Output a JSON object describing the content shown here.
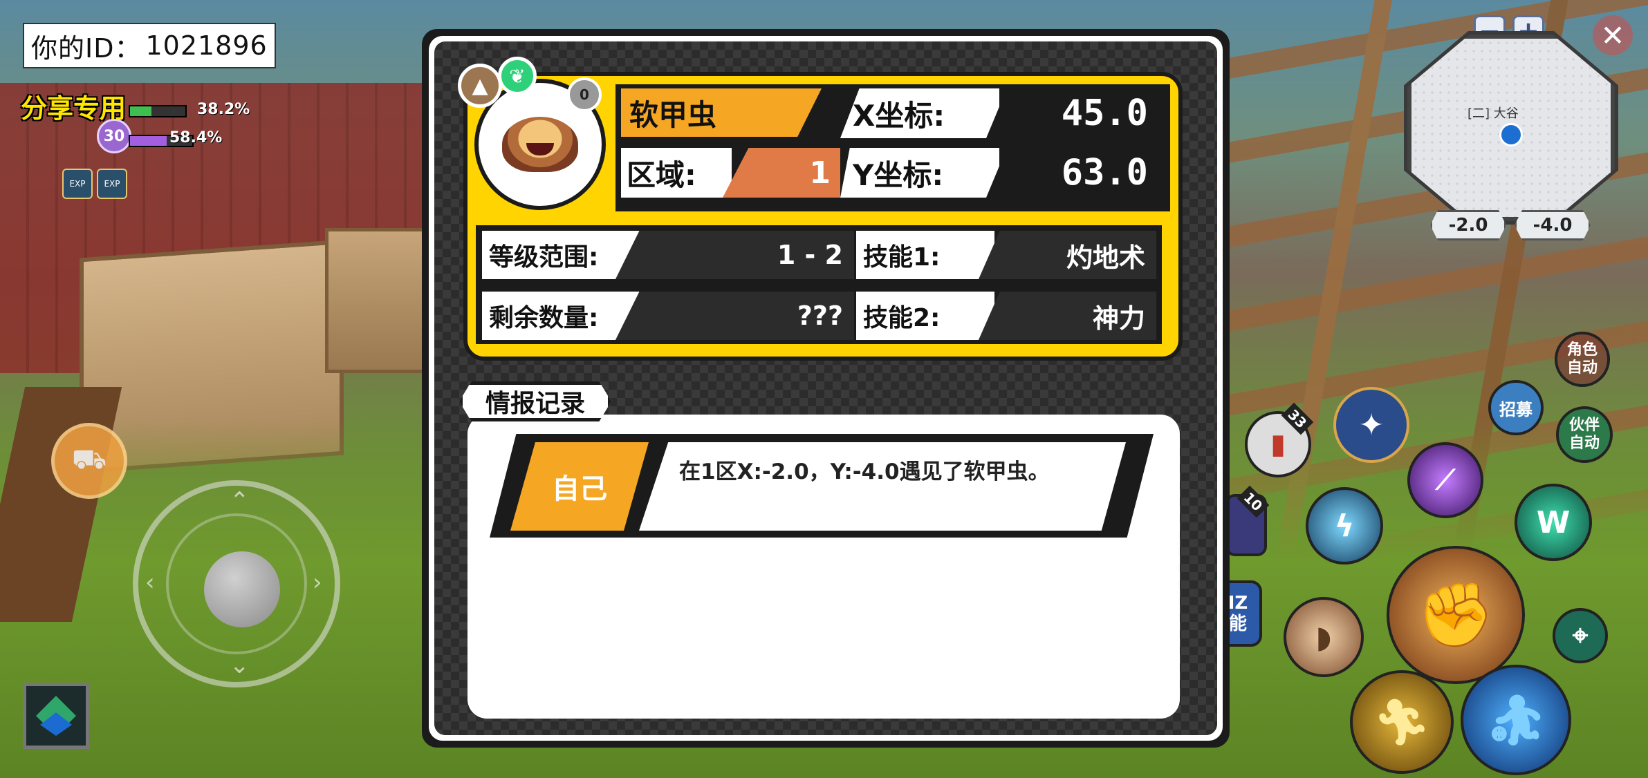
{
  "hud": {
    "player_id_label": "你的ID：",
    "player_id_value": "1021896",
    "share_label": "分享专用",
    "level": "30",
    "bar1_percent": "38.2%",
    "bar2_percent": "58.4%",
    "bar1_fill": 0.382,
    "bar2_fill": 0.584,
    "exp_icon_1": "EXP",
    "exp_icon_2": "EXP"
  },
  "minimap": {
    "location_label": "[二] 大谷",
    "coord_x": "-2.0",
    "coord_y": "-4.0",
    "zoom_out_label": "−",
    "zoom_in_label": "+",
    "close_label": "✕"
  },
  "skills": {
    "item1_count": "33",
    "item2_count": "10",
    "auto_role_label": "角色自动",
    "auto_partner_label": "伙伴自动",
    "recruit_label": "招募",
    "skill_side_label": "IZ能"
  },
  "monster": {
    "name": "软甲虫",
    "zone_label": "区域:",
    "zone_value": "1",
    "x_label": "X坐标:",
    "x_value": "45.0",
    "y_label": "Y坐标:",
    "y_value": "63.0",
    "level_range_label": "等级范围:",
    "level_range_value": "1 - 2",
    "remaining_label": "剩余数量:",
    "remaining_value": "???",
    "skill1_label": "技能1:",
    "skill1_value": "灼地术",
    "skill2_label": "技能2:",
    "skill2_value": "神力",
    "badge_small": "0",
    "icons": [
      "mountain-type-icon",
      "butterfly-type-icon",
      "gray-badge-icon"
    ]
  },
  "records": {
    "tab_label": "情报记录",
    "entries": [
      {
        "who": "自己",
        "text": "在1区X:-2.0，Y:-4.0遇见了软甲虫。"
      }
    ]
  },
  "colors": {
    "panel_yellow": "#ffd400",
    "name_orange": "#f5a623",
    "zone_orange": "#e07b47",
    "dark": "#1b1b1b"
  }
}
